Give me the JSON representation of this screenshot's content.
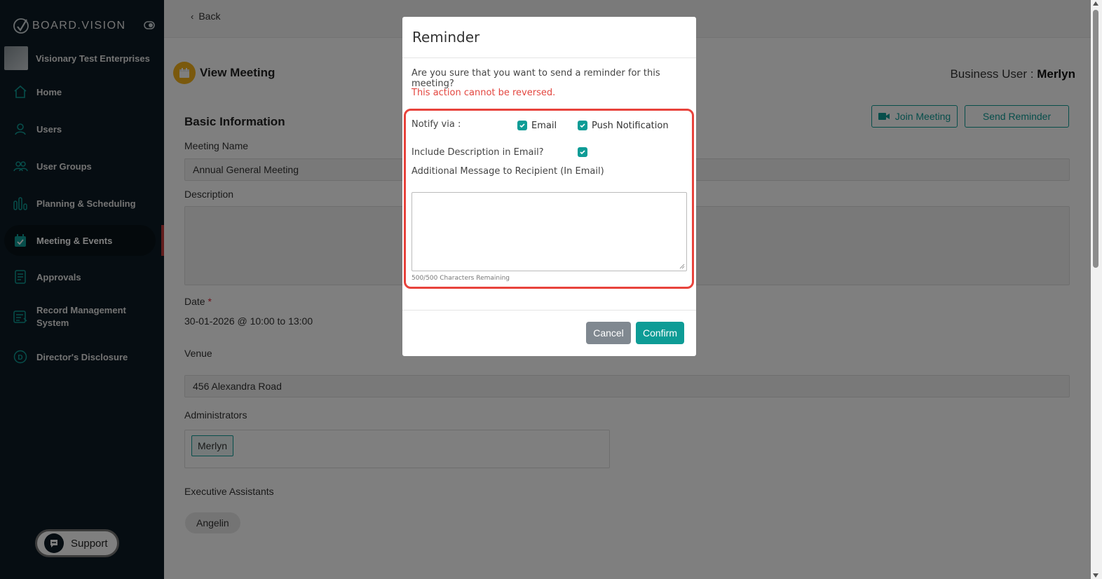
{
  "sidebar": {
    "logo_text": "BOARD.VISION",
    "org_name": "Visionary Test Enterprises",
    "items": [
      {
        "label": "Home",
        "icon": "home-icon"
      },
      {
        "label": "Users",
        "icon": "user-icon"
      },
      {
        "label": "User Groups",
        "icon": "user-group-icon"
      },
      {
        "label": "Planning & Scheduling",
        "icon": "bar-chart-icon"
      },
      {
        "label": "Meeting & Events",
        "icon": "calendar-icon",
        "active": true
      },
      {
        "label": "Approvals",
        "icon": "document-icon"
      },
      {
        "label": "Record Management System",
        "icon": "record-icon"
      },
      {
        "label": "Director's Disclosure",
        "icon": "disclosure-icon"
      }
    ],
    "support_label": "Support"
  },
  "topbar": {
    "back_label": "Back"
  },
  "page": {
    "title": "View Meeting",
    "business_user_label": "Business User : ",
    "business_user_name": "Merlyn"
  },
  "actions": {
    "join_meeting": "Join Meeting",
    "send_reminder": "Send Reminder"
  },
  "basic_info": {
    "section_title": "Basic Information",
    "meeting_name_label": "Meeting Name",
    "meeting_name_value": "Annual General Meeting",
    "description_label": "Description",
    "date_label": "Date",
    "required_mark": "*",
    "date_value": "30-01-2026 @ 10:00 to 13:00",
    "venue_label": "Venue",
    "venue_value": "456 Alexandra Road",
    "administrators_label": "Administrators",
    "administrators": [
      "Merlyn"
    ],
    "exec_assistants_label": "Executive Assistants",
    "exec_assistants": [
      "Angelin"
    ]
  },
  "modal": {
    "title": "Reminder",
    "question": "Are you sure that you want to send a reminder for this meeting?",
    "warning": "This action cannot be reversed.",
    "notify_label": "Notify via :",
    "email_label": "Email",
    "email_checked": true,
    "push_label": "Push Notification",
    "push_checked": true,
    "include_desc_label": "Include Description in Email?",
    "include_desc_checked": true,
    "additional_msg_label": "Additional Message to Recipient (In Email)",
    "message_value": "",
    "counter": "500/500 Characters Remaining",
    "cancel_label": "Cancel",
    "confirm_label": "Confirm"
  },
  "colors": {
    "sidebar_bg": "#0d1b24",
    "accent": "#0e9c96",
    "warning": "#e3463f",
    "highlight": "#e8433c",
    "active_indicator": "#c43b3b"
  }
}
